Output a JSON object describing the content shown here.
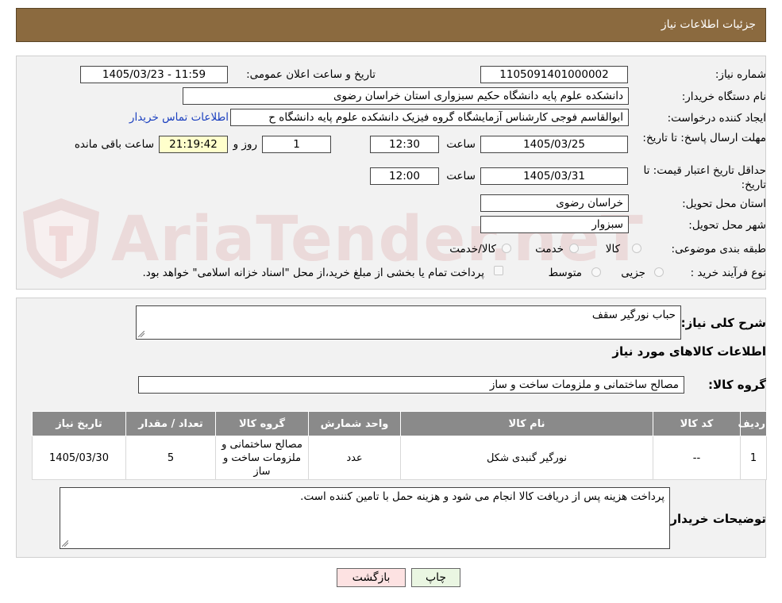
{
  "header": {
    "title": "جزئیات اطلاعات نیاز"
  },
  "watermark": {
    "text": "AriaTender.neT"
  },
  "form": {
    "need_number_label": "شماره نیاز:",
    "need_number": "1105091401000002",
    "announce_label": "تاریخ و ساعت اعلان عمومی:",
    "announce_value": "1405/03/23 - 11:59",
    "buyer_label": "نام دستگاه خریدار:",
    "buyer_value": "دانشکده علوم پایه دانشگاه حکیم سبزواری استان خراسان رضوی",
    "creator_label": "ایجاد کننده درخواست:",
    "creator_value": "ابوالقاسم فوجی کارشناس آزمایشگاه گروه فیزیک دانشکده علوم پایه دانشگاه ح",
    "contact_link": "اطلاعات تماس خریدار",
    "deadline_label": "مهلت ارسال پاسخ: تا تاریخ:",
    "deadline_date": "1405/03/25",
    "time_label": "ساعت",
    "deadline_time": "12:30",
    "days_value": "1",
    "days_label": "روز و",
    "remaining_value": "21:19:42",
    "remaining_label": "ساعت باقی مانده",
    "validity_label": "حداقل تاریخ اعتبار قیمت: تا تاریخ:",
    "validity_date": "1405/03/31",
    "validity_time": "12:00",
    "province_label": "استان محل تحویل:",
    "province_value": "خراسان رضوی",
    "city_label": "شهر محل تحویل:",
    "city_value": "سبزوار",
    "category_label": "طبقه بندی موضوعی:",
    "category_options": [
      "کالا",
      "خدمت",
      "کالا/خدمت"
    ],
    "process_label": "نوع فرآیند خرید :",
    "process_options": [
      "جزیی",
      "متوسط"
    ],
    "payment_note": "پرداخت تمام یا بخشی از مبلغ خرید،از محل \"اسناد خزانه اسلامی\" خواهد بود."
  },
  "details": {
    "desc_label": "شرح کلی نیاز:",
    "desc_value": "حباب نورگیر سقف",
    "items_title": "اطلاعات کالاهای مورد نیاز",
    "group_label": "گروه کالا:",
    "group_value": "مصالح ساختمانی و ملزومات ساخت و ساز",
    "table": {
      "headers": [
        "ردیف",
        "کد کالا",
        "نام کالا",
        "واحد شمارش",
        "گروه کالا",
        "تعداد / مقدار",
        "تاریخ نیاز"
      ],
      "rows": [
        [
          "1",
          "--",
          "نورگیر گنبدی شکل",
          "عدد",
          "مصالح ساختمانی و ملزومات ساخت و ساز",
          "5",
          "1405/03/30"
        ]
      ]
    },
    "notes_label": "توضیحات خریدار:",
    "notes_value": "پرداخت هزینه پس از دریافت کالا انجام می شود و هزینه حمل با تامین کننده است."
  },
  "buttons": {
    "print": "چاپ",
    "back": "بازگشت"
  }
}
